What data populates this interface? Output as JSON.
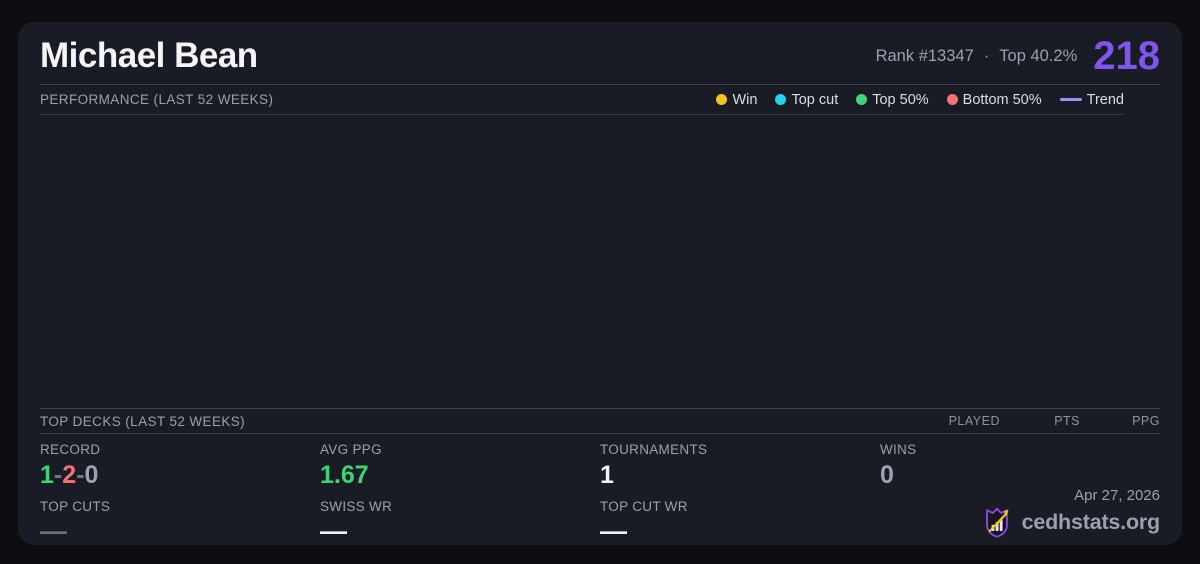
{
  "header": {
    "player_name": "Michael Bean",
    "rank": "Rank #13347",
    "dot_separator": "·",
    "top_percent": "Top 40.2%",
    "points": "218"
  },
  "performance": {
    "title": "PERFORMANCE (LAST 52 WEEKS)",
    "legend": {
      "win": "Win",
      "top_cut": "Top cut",
      "top_50": "Top 50%",
      "bottom_50": "Bottom 50%",
      "trend": "Trend"
    },
    "legend_colors": {
      "win": "#f2c41d",
      "top_cut": "#22d3ee",
      "top_50": "#44d478",
      "bottom_50": "#f87171",
      "trend": "#a78bfa"
    }
  },
  "chart_data": {
    "type": "scatter",
    "title": "PERFORMANCE (LAST 52 WEEKS)",
    "series": [
      {
        "name": "Win",
        "points": []
      },
      {
        "name": "Top cut",
        "points": []
      },
      {
        "name": "Top 50%",
        "points": []
      },
      {
        "name": "Bottom 50%",
        "points": []
      },
      {
        "name": "Trend",
        "points": []
      }
    ],
    "note": "plot area renders empty in the screenshot",
    "legend_position": "top-right",
    "grid": false
  },
  "top_decks": {
    "title": "TOP DECKS (LAST 52 WEEKS)",
    "columns": [
      "PLAYED",
      "PTS",
      "PPG"
    ],
    "rows": []
  },
  "stats": {
    "record": {
      "label": "RECORD",
      "wins": "1",
      "losses": "2",
      "draws": "0",
      "separator": "-"
    },
    "avg_ppg": {
      "label": "AVG PPG",
      "value": "1.67"
    },
    "tournaments": {
      "label": "TOURNAMENTS",
      "value": "1"
    },
    "wins": {
      "label": "WINS",
      "value": "0"
    },
    "top_cuts": {
      "label": "TOP CUTS",
      "value": "—"
    },
    "swiss_wr": {
      "label": "SWISS WR",
      "value": "—"
    },
    "top_cut_wr": {
      "label": "TOP CUT WR",
      "value": "—"
    }
  },
  "footer": {
    "date": "Apr 27, 2026",
    "brand": "cedhstats.org"
  },
  "theme": {
    "accent_purple": "#7e55ee",
    "positive_green": "#3ed474",
    "negative_red": "#f87171",
    "muted_gray": "#9ca3af",
    "card_bg": "#191c25",
    "page_bg": "#0d0e11"
  }
}
